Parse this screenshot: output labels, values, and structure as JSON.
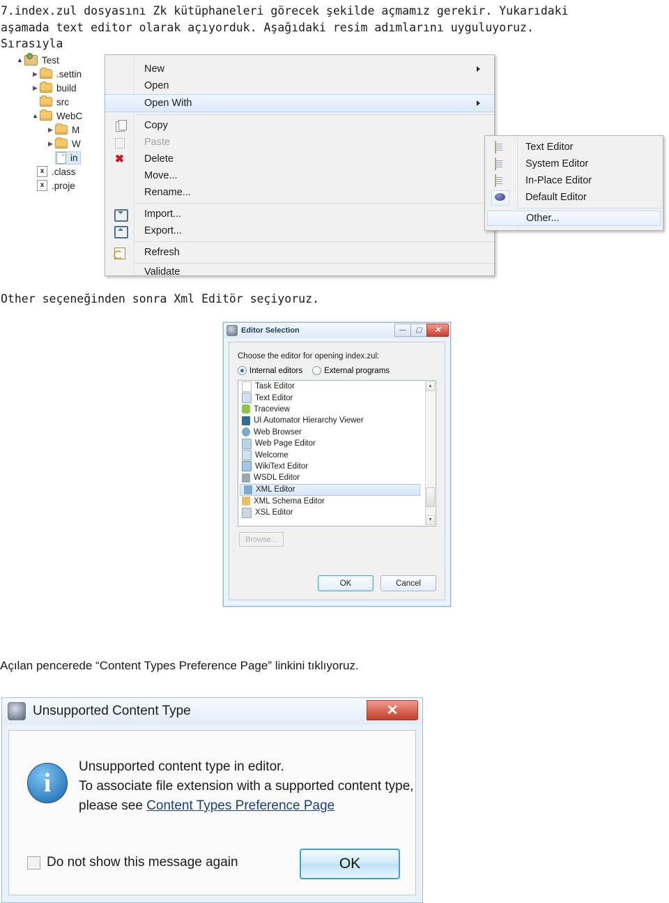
{
  "intro": {
    "lines": [
      "7.index.zul dosyasını Zk kütüphaneleri görecek şekilde açmamız gerekir. Yukarıdaki",
      "aşamada text editor olarak açıyorduk. Aşağıdaki resim adımlarını uyguluyoruz.",
      "Sırasıyla"
    ]
  },
  "caption1": "Other seçeneğinden sonra Xml Editör seçiyoruz.",
  "caption2": "Açılan pencerede “Content Types Preference Page” linkini  tıklıyoruz.",
  "tree": {
    "nodes": [
      {
        "label": "Test",
        "icon": "project-icon",
        "twist": "open",
        "indent": 0
      },
      {
        "label": ".settin",
        "icon": "folder-icon",
        "twist": "closed",
        "indent": 1
      },
      {
        "label": "build",
        "icon": "folder-icon",
        "twist": "closed",
        "indent": 1
      },
      {
        "label": "src",
        "icon": "folder-icon",
        "twist": "none",
        "indent": 1
      },
      {
        "label": "WebC",
        "icon": "folder-icon",
        "twist": "open",
        "indent": 1
      },
      {
        "label": "M",
        "icon": "folder-icon",
        "twist": "closed",
        "indent": 2
      },
      {
        "label": "W",
        "icon": "folder-icon",
        "twist": "closed",
        "indent": 2
      },
      {
        "label": "in",
        "icon": "file-icon",
        "twist": "none",
        "indent": 3,
        "selected": true
      },
      {
        "label": ".class",
        "icon": "x-file-icon",
        "twist": "none",
        "indent": 1
      },
      {
        "label": ".proje",
        "icon": "x-file-icon",
        "twist": "none",
        "indent": 1
      }
    ]
  },
  "context_menu": {
    "items": [
      {
        "label": "New",
        "icon": null,
        "submenu": true,
        "disabled": false,
        "selected": false,
        "sep_after": false
      },
      {
        "label": "Open",
        "icon": null,
        "submenu": false,
        "disabled": false,
        "selected": false,
        "sep_after": false
      },
      {
        "label": "Open With",
        "icon": null,
        "submenu": true,
        "disabled": false,
        "selected": true,
        "sep_after": true
      },
      {
        "label": "Copy",
        "icon": "copy-icon",
        "submenu": false,
        "disabled": false,
        "selected": false,
        "sep_after": false
      },
      {
        "label": "Paste",
        "icon": "paste-icon",
        "submenu": false,
        "disabled": true,
        "selected": false,
        "sep_after": false
      },
      {
        "label": "Delete",
        "icon": "delete-icon",
        "submenu": false,
        "disabled": false,
        "selected": false,
        "sep_after": false
      },
      {
        "label": "Move...",
        "icon": null,
        "submenu": false,
        "disabled": false,
        "selected": false,
        "sep_after": false
      },
      {
        "label": "Rename...",
        "icon": null,
        "submenu": false,
        "disabled": false,
        "selected": false,
        "sep_after": true
      },
      {
        "label": "Import...",
        "icon": "import-icon",
        "submenu": false,
        "disabled": false,
        "selected": false,
        "sep_after": false
      },
      {
        "label": "Export...",
        "icon": "export-icon",
        "submenu": false,
        "disabled": false,
        "selected": false,
        "sep_after": true
      },
      {
        "label": "Refresh",
        "icon": "refresh-icon",
        "submenu": false,
        "disabled": false,
        "selected": false,
        "sep_after": true
      },
      {
        "label": "Validate",
        "icon": null,
        "submenu": false,
        "disabled": false,
        "selected": false,
        "sep_after": false
      }
    ]
  },
  "open_with_submenu": {
    "items": [
      {
        "label": "Text Editor",
        "icon": "document-icon",
        "boxed": false
      },
      {
        "label": "System Editor",
        "icon": "document-icon",
        "boxed": false
      },
      {
        "label": "In-Place Editor",
        "icon": "document-icon",
        "boxed": false
      },
      {
        "label": "Default Editor",
        "icon": "orb-icon",
        "boxed": false
      },
      {
        "label": "Other...",
        "icon": null,
        "boxed": true
      }
    ]
  },
  "editor_selection_dialog": {
    "title": "Editor Selection",
    "titlebar_buttons": [
      "minimize",
      "maximize",
      "close"
    ],
    "prompt": "Choose the editor for opening index.zul:",
    "radios": [
      {
        "label": "Internal editors",
        "selected": true
      },
      {
        "label": "External programs",
        "selected": false
      }
    ],
    "editors": [
      {
        "label": "Task Editor",
        "color": "#ffffff",
        "selected": false
      },
      {
        "label": "Text Editor",
        "color": "#cfe0f0",
        "selected": false
      },
      {
        "label": "Traceview",
        "color": "#8cc63f",
        "selected": false
      },
      {
        "label": "UI Automator Hierarchy Viewer",
        "color": "#2f6f8f",
        "selected": false
      },
      {
        "label": "Web Browser",
        "color": "#7fa8c9",
        "selected": false
      },
      {
        "label": "Web Page Editor",
        "color": "#b9d4ea",
        "selected": false
      },
      {
        "label": "Welcome",
        "color": "#cfe0f0",
        "selected": false
      },
      {
        "label": "WikiText Editor",
        "color": "#9fc7e8",
        "selected": false
      },
      {
        "label": "WSDL Editor",
        "color": "#9aa7b5",
        "selected": false
      },
      {
        "label": "XML Editor",
        "color": "#7fa8c9",
        "selected": true
      },
      {
        "label": "XML Schema Editor",
        "color": "#e8c06a",
        "selected": false
      },
      {
        "label": "XSL Editor",
        "color": "#cdd6de",
        "selected": false
      }
    ],
    "browse_label": "Browse...",
    "ok_label": "OK",
    "cancel_label": "Cancel"
  },
  "unsupported_dialog": {
    "title": "Unsupported Content Type",
    "close_label": "✕",
    "icon": "info-icon",
    "icon_glyph": "i",
    "message_line1": "Unsupported content type in editor.",
    "message_line2": "To associate file extension with a supported content type,",
    "message_line3_prefix": "please see ",
    "message_link": "Content Types Preference Page",
    "checkbox_label": "Do not show this message again",
    "checkbox_checked": false,
    "ok_label": "OK"
  },
  "colors": {
    "link": "#1a3f7a",
    "selection": "#d5e6f8",
    "close_button": "#c33d29",
    "info_blue": "#1464ad"
  }
}
